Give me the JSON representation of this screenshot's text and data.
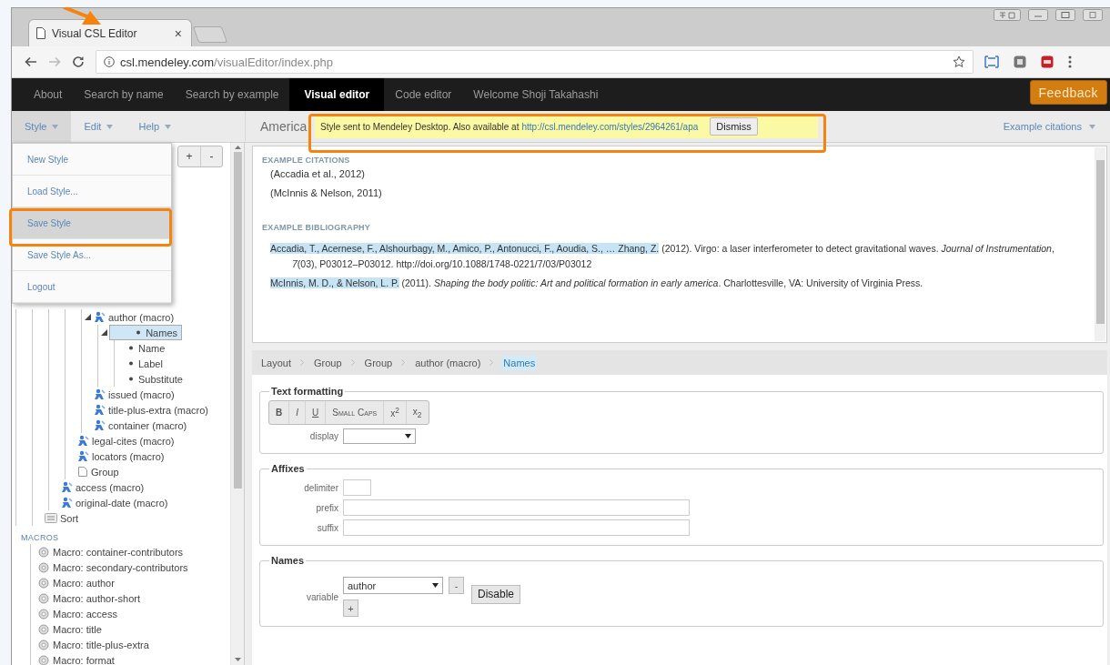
{
  "browser": {
    "tab_title": "Visual CSL Editor",
    "tab_close": "×",
    "url_domain": "csl.mendeley.com",
    "url_path": "/visualEditor/index.php"
  },
  "nav": {
    "items": [
      {
        "label": "About",
        "selected": false
      },
      {
        "label": "Search by name",
        "selected": false
      },
      {
        "label": "Search by example",
        "selected": false
      },
      {
        "label": "Visual editor",
        "selected": true
      },
      {
        "label": "Code editor",
        "selected": false
      }
    ],
    "welcome": "Welcome Shoji Takahashi",
    "feedback": "Feedback"
  },
  "toolbar": {
    "menus": [
      {
        "label": "Style",
        "selected": true
      },
      {
        "label": "Edit",
        "selected": false
      },
      {
        "label": "Help",
        "selected": false
      }
    ],
    "style_title": "America",
    "notification": {
      "text": "Style sent to Mendeley Desktop. Also available at",
      "link": "http://csl.mendeley.com/styles/2964261/apa",
      "dismiss": "Dismiss"
    },
    "view_menu": "Example citations"
  },
  "style_menu": [
    {
      "label": "New Style",
      "selected": false
    },
    {
      "label": "Load Style...",
      "selected": false
    },
    {
      "label": "Save Style",
      "selected": true
    },
    {
      "label": "Save Style As...",
      "selected": false
    },
    {
      "label": "Logout",
      "selected": false
    }
  ],
  "tree_buttons": [
    "+",
    "-"
  ],
  "tree": [
    {
      "children": [
        {
          "children": [
            {
              "children": [
                {
                  "children": [
                    {
                      "label": "author (macro)",
                      "kind": "macro",
                      "expanded": true,
                      "selected": false,
                      "children": [
                        {
                          "label": "Names",
                          "kind": "bullet",
                          "expanded": true,
                          "selected": true,
                          "children": [
                            {
                              "label": "Name",
                              "kind": "bullet",
                              "expanded": false,
                              "selected": false
                            },
                            {
                              "label": "Label",
                              "kind": "bullet",
                              "expanded": false,
                              "selected": false
                            },
                            {
                              "label": "Substitute",
                              "kind": "bullet",
                              "expanded": false,
                              "selected": false
                            }
                          ]
                        }
                      ]
                    },
                    {
                      "label": "issued (macro)",
                      "kind": "macro",
                      "expanded": false,
                      "selected": false
                    },
                    {
                      "label": "title-plus-extra (macro)",
                      "kind": "macro",
                      "expanded": false,
                      "selected": false
                    },
                    {
                      "label": "container (macro)",
                      "kind": "macro",
                      "expanded": false,
                      "selected": false
                    }
                  ]
                },
                {
                  "label": "legal-cites (macro)",
                  "kind": "macro",
                  "expanded": false,
                  "selected": false
                },
                {
                  "label": "locators (macro)",
                  "kind": "macro",
                  "expanded": false,
                  "selected": false
                },
                {
                  "label": "Group",
                  "kind": "group",
                  "expanded": false,
                  "selected": false
                }
              ]
            },
            {
              "label": "access (macro)",
              "kind": "macro",
              "expanded": false,
              "selected": false
            },
            {
              "label": "original-date (macro)",
              "kind": "macro",
              "expanded": false,
              "selected": false
            }
          ]
        },
        {
          "label": "Sort",
          "kind": "sort",
          "expanded": false,
          "selected": false
        }
      ]
    }
  ],
  "macros": {
    "heading": "MACROS",
    "items": [
      "Macro: container-contributors",
      "Macro: secondary-contributors",
      "Macro: author",
      "Macro: author-short",
      "Macro: access",
      "Macro: title",
      "Macro: title-plus-extra",
      "Macro: format"
    ]
  },
  "citations": {
    "heading": "EXAMPLE CITATIONS",
    "items": [
      "(Accadia et al., 2012)",
      "(McInnis & Nelson, 2011)"
    ]
  },
  "bibliography": {
    "heading": "EXAMPLE BIBLIOGRAPHY",
    "entries": [
      {
        "authors": "Accadia, T., Acernese, F., Alshourbagy, M., Amico, P., Antonucci, F., Aoudia, S., … Zhang, Z.",
        "highlighted": true,
        "rest": "(2012). Virgo: a laser interferometer to detect gravitational waves. *Journal of Instrumentation*, *7*(03), P03012–P03012. http://doi.org/10.1088/1748-0221/7/03/P03012"
      },
      {
        "authors": "McInnis, M. D., & Nelson, L. P.",
        "highlighted": true,
        "rest": "(2011). *Shaping the body politic: Art and political formation in early america*. Charlottesville, VA: University of Virginia Press."
      }
    ]
  },
  "breadcrumb": [
    {
      "label": "Layout",
      "selected": false
    },
    {
      "label": "Group",
      "selected": false
    },
    {
      "label": "Group",
      "selected": false
    },
    {
      "label": "author (macro)",
      "selected": false
    },
    {
      "label": "Names",
      "selected": true
    }
  ],
  "form": [
    {
      "kind": "formatting",
      "title": "Text formatting",
      "buttons": [
        {
          "kind": "bold",
          "label": "B"
        },
        {
          "kind": "italic",
          "label": "I"
        },
        {
          "kind": "underline",
          "label": "U"
        },
        {
          "kind": "smallcaps",
          "label": "Small Caps"
        },
        {
          "kind": "sup",
          "label": "x$^{2}$"
        },
        {
          "kind": "sub",
          "label": "x$_{2}$"
        }
      ],
      "display_label": "display"
    },
    {
      "kind": "affixes",
      "title": "Affixes",
      "fields": [
        {
          "kind": "short",
          "label": "delimiter"
        },
        {
          "kind": "long",
          "label": "prefix"
        },
        {
          "kind": "long",
          "label": "suffix"
        }
      ]
    },
    {
      "kind": "names",
      "title": "Names",
      "variable_label": "variable",
      "variable_value": "author",
      "remove": "-",
      "add": "+",
      "disable": "Disable"
    }
  ]
}
